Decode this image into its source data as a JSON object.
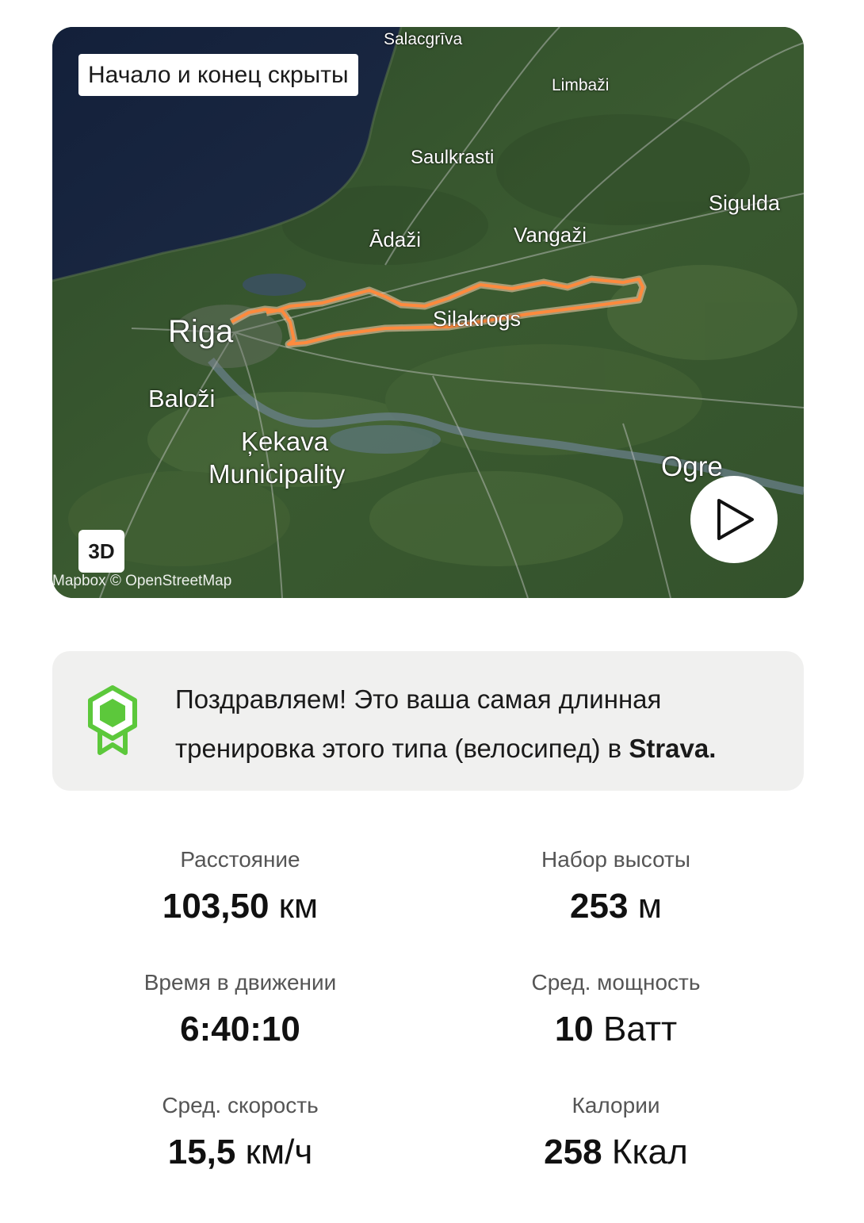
{
  "map": {
    "privacy_badge": "Начало и конец скрыты",
    "button_3d": "3D",
    "attribution": "Mapbox © OpenStreetMap",
    "play_icon": "play-icon",
    "route_color": "#ff8a3d",
    "places": {
      "salacgriva": "Salacgrīva",
      "limbazi": "Limbaži",
      "saulkrasti": "Saulkrasti",
      "sigulda": "Sigulda",
      "adazi": "Ādaži",
      "vangazi": "Vangaži",
      "riga": "Riga",
      "silakrogs": "Silakrogs",
      "balozi": "Baloži",
      "kekava_1": "Ķekava",
      "kekava_2": "Municipality",
      "ogre": "Ogre"
    }
  },
  "achievement": {
    "icon": "achievement-badge-icon",
    "icon_color": "#5cc83b",
    "text": "Поздравляем! Это ваша самая длинная тренировка этого типа (велосипед) в ",
    "brand": "Strava."
  },
  "stats": {
    "distance": {
      "label": "Расстояние",
      "number": "103,50",
      "unit": "км"
    },
    "elevation": {
      "label": "Набор высоты",
      "number": "253",
      "unit": "м"
    },
    "moving_time": {
      "label": "Время в движении",
      "number": "6:40:10",
      "unit": ""
    },
    "avg_power": {
      "label": "Сред. мощность",
      "number": "10",
      "unit": "Ватт"
    },
    "avg_speed": {
      "label": "Сред. скорость",
      "number": "15,5",
      "unit": "км/ч"
    },
    "calories": {
      "label": "Калории",
      "number": "258",
      "unit": "Ккал"
    }
  }
}
